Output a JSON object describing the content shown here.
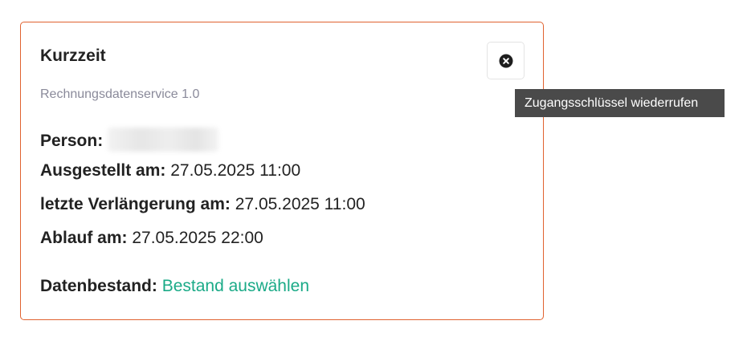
{
  "card": {
    "title": "Kurzzeit",
    "subtitle": "Rechnungsdatenservice 1.0",
    "close_icon": "close-circle-icon",
    "border_color": "#e0622f",
    "fields": {
      "person_label": "Person:",
      "issued_label": "Ausgestellt am:",
      "issued_value": "27.05.2025 11:00",
      "renewal_label": "letzte Verlängerung am:",
      "renewal_value": "27.05.2025 11:00",
      "expiry_label": "Ablauf am:",
      "expiry_value": "27.05.2025 22:00",
      "dataset_label": "Datenbestand:",
      "dataset_link": "Bestand auswählen",
      "link_color": "#1aaa87"
    }
  },
  "tooltip": {
    "text": "Zugangsschlüssel wiederrufen"
  }
}
